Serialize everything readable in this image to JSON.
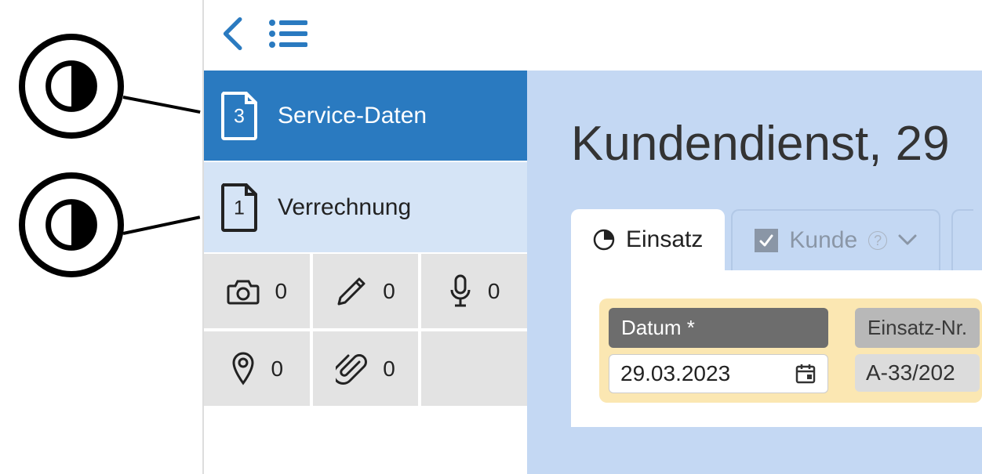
{
  "sidebar": {
    "items": [
      {
        "label": "Service-Daten",
        "badge": "3"
      },
      {
        "label": "Verrechnung",
        "badge": "1"
      }
    ]
  },
  "icon_grid": {
    "camera": "0",
    "pencil": "0",
    "mic": "0",
    "pin": "0",
    "clip": "0"
  },
  "main": {
    "title_prefix": "Kundendienst",
    "title_suffix": ", 29"
  },
  "tabs": {
    "einsatz": "Einsatz",
    "kunde": "Kunde"
  },
  "fields": {
    "datum_label": "Datum *",
    "datum_value": "29.03.2023",
    "einsatznr_label": "Einsatz-Nr.",
    "einsatznr_value": "A-33/202"
  }
}
